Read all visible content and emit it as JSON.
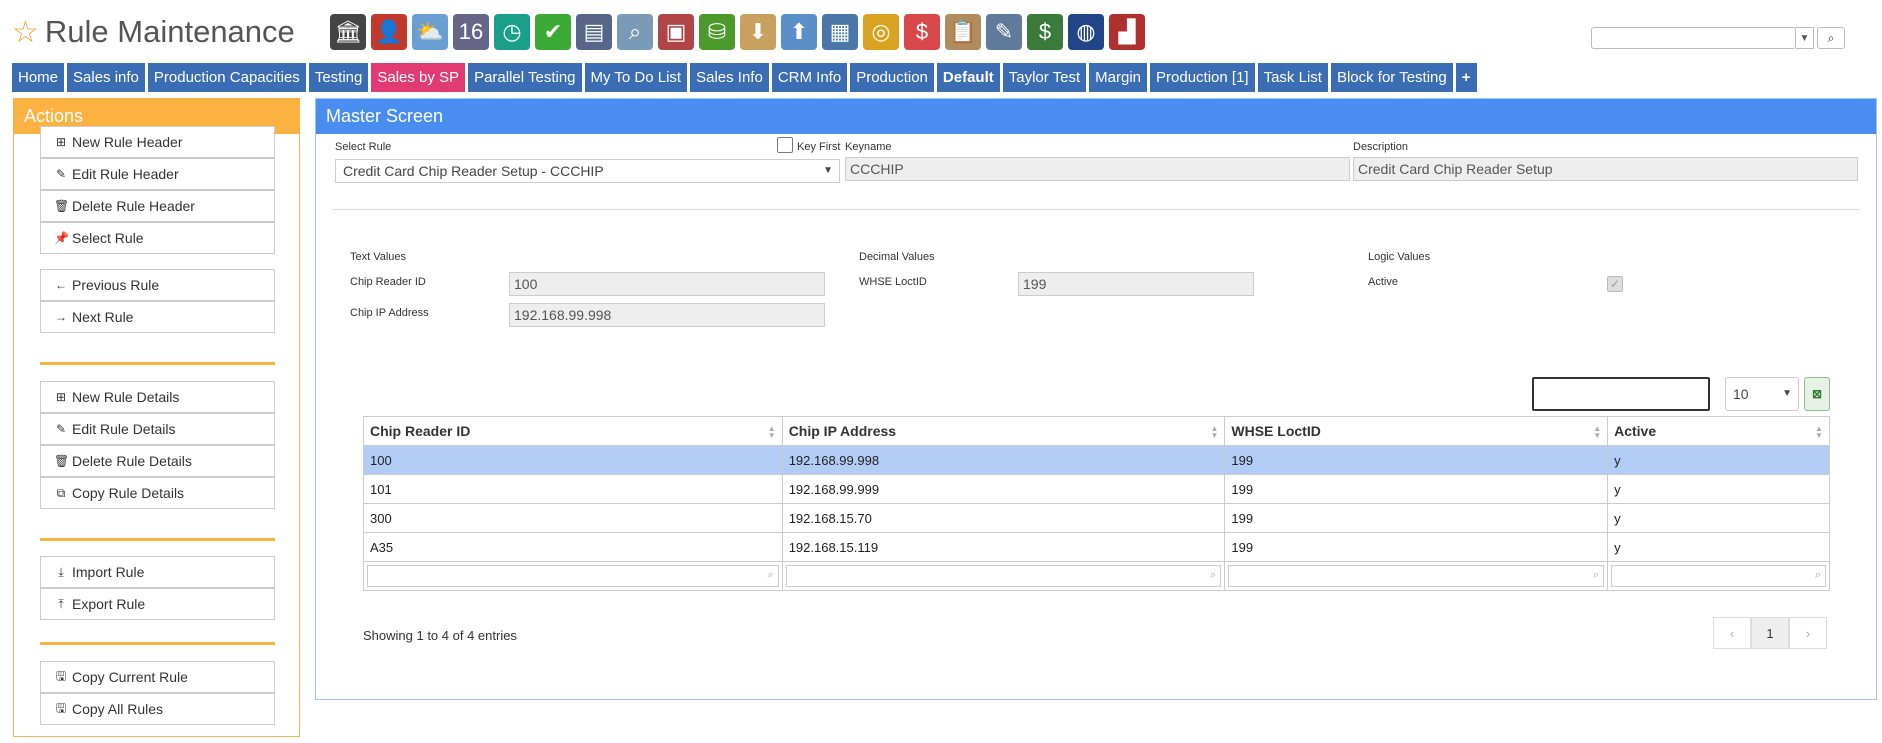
{
  "app": {
    "title": "Rule Maintenance"
  },
  "toolbar_icons": [
    {
      "name": "bank-icon",
      "glyph": "🏛",
      "color": "#444444"
    },
    {
      "name": "user-icon",
      "glyph": "👤",
      "color": "#c0392b"
    },
    {
      "name": "weather-icon",
      "glyph": "⛅",
      "color": "#6a9fd4"
    },
    {
      "name": "calendar-icon",
      "glyph": "16",
      "color": "#666688"
    },
    {
      "name": "clock-icon",
      "glyph": "◷",
      "color": "#1aa08a"
    },
    {
      "name": "checkmark-icon",
      "glyph": "✔",
      "color": "#3aaa35"
    },
    {
      "name": "window-icon",
      "glyph": "▤",
      "color": "#556688"
    },
    {
      "name": "magnifier-icon",
      "glyph": "⌕",
      "color": "#7a9ab8"
    },
    {
      "name": "bus-icon",
      "glyph": "▣",
      "color": "#b04545"
    },
    {
      "name": "basket-icon",
      "glyph": "⛁",
      "color": "#4c9a2a"
    },
    {
      "name": "download-box-icon",
      "glyph": "⬇",
      "color": "#c8a060"
    },
    {
      "name": "upload-box-icon",
      "glyph": "⬆",
      "color": "#5b8fc8"
    },
    {
      "name": "board-icon",
      "glyph": "▦",
      "color": "#4a77a8"
    },
    {
      "name": "coins-icon",
      "glyph": "◎",
      "color": "#d9a321"
    },
    {
      "name": "dollar-chat-icon",
      "glyph": "$",
      "color": "#d94848"
    },
    {
      "name": "clipboard-icon",
      "glyph": "📋",
      "color": "#b08b5e"
    },
    {
      "name": "pencil-icon",
      "glyph": "✎",
      "color": "#5f7a9a"
    },
    {
      "name": "money-icon",
      "glyph": "$",
      "color": "#3a7a3a"
    },
    {
      "name": "globe-book-icon",
      "glyph": "◍",
      "color": "#224488"
    },
    {
      "name": "factory-icon",
      "glyph": "▟",
      "color": "#b03030"
    }
  ],
  "tabs": [
    {
      "label": "Home",
      "style": ""
    },
    {
      "label": "Sales info",
      "style": ""
    },
    {
      "label": "Production Capacities",
      "style": ""
    },
    {
      "label": "Testing",
      "style": ""
    },
    {
      "label": "Sales by SP",
      "style": "pink"
    },
    {
      "label": "Parallel Testing",
      "style": ""
    },
    {
      "label": "My To Do List",
      "style": ""
    },
    {
      "label": "Sales Info",
      "style": ""
    },
    {
      "label": "CRM Info",
      "style": ""
    },
    {
      "label": "Production",
      "style": ""
    },
    {
      "label": "Default",
      "style": "bold"
    },
    {
      "label": "Taylor Test",
      "style": ""
    },
    {
      "label": "Margin",
      "style": ""
    },
    {
      "label": "Production [1]",
      "style": ""
    },
    {
      "label": "Task List",
      "style": ""
    },
    {
      "label": "Block for Testing",
      "style": ""
    },
    {
      "label": "+",
      "style": "bold"
    }
  ],
  "actions": {
    "title": "Actions",
    "new_rule_header": "New Rule Header",
    "edit_rule_header": "Edit Rule Header",
    "delete_rule_header": "Delete Rule Header",
    "select_rule": "Select Rule",
    "previous_rule": "Previous Rule",
    "next_rule": "Next Rule",
    "new_rule_details": "New Rule Details",
    "edit_rule_details": "Edit Rule Details",
    "delete_rule_details": "Delete Rule Details",
    "copy_rule_details": "Copy Rule Details",
    "import_rule": "Import Rule",
    "export_rule": "Export Rule",
    "copy_current_rule": "Copy Current Rule",
    "copy_all_rules": "Copy All Rules"
  },
  "master": {
    "title": "Master Screen",
    "select_rule_label": "Select Rule",
    "select_rule_value": "Credit Card Chip Reader Setup - CCCHIP",
    "key_first_label": "Key First",
    "key_first_checked": false,
    "keyname_label": "Keyname",
    "keyname_value": "CCCHIP",
    "description_label": "Description",
    "description_value": "Credit Card Chip Reader Setup",
    "text_values_label": "Text Values",
    "chip_reader_id_label": "Chip Reader ID",
    "chip_reader_id_value": "100",
    "chip_ip_label": "Chip IP Address",
    "chip_ip_value": "192.168.99.998",
    "decimal_values_label": "Decimal Values",
    "whse_label": "WHSE LoctID",
    "whse_value": "199",
    "logic_values_label": "Logic Values",
    "active_label": "Active",
    "active_checked": true
  },
  "table": {
    "search_value": "",
    "page_size": "10",
    "columns": [
      "Chip Reader ID",
      "Chip IP Address",
      "WHSE LoctID",
      "Active"
    ],
    "rows": [
      [
        "100",
        "192.168.99.998",
        "199",
        "y"
      ],
      [
        "101",
        "192.168.99.999",
        "199",
        "y"
      ],
      [
        "300",
        "192.168.15.70",
        "199",
        "y"
      ],
      [
        "A35",
        "192.168.15.119",
        "199",
        "y"
      ]
    ],
    "selected_row": 0,
    "info": "Showing 1 to 4 of 4 entries",
    "pager": {
      "prev": "‹",
      "current": "1",
      "next": "›"
    }
  }
}
